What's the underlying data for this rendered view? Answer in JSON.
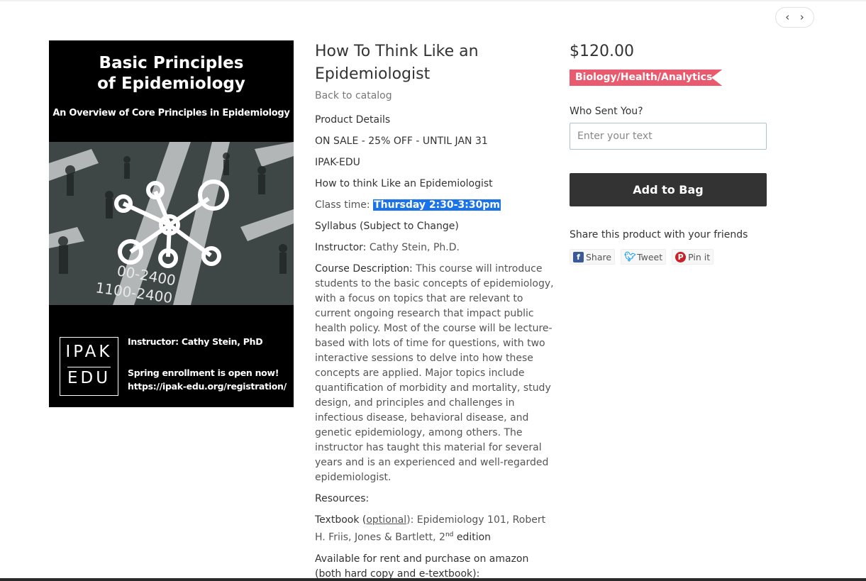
{
  "nav": {
    "prev": "‹",
    "next": "›"
  },
  "poster": {
    "title_line1": "Basic Principles",
    "title_line2": "of Epidemiology",
    "subtitle": "An Overview of Core Principles in Epidemiology",
    "logo_line1": "IPAK",
    "logo_line2": "EDU",
    "instructor": "Instructor: Cathy Stein, PhD",
    "enroll_line1": "Spring enrollment is open now!",
    "enroll_line2": "https://ipak-edu.org/registration/",
    "street_text_1": "00-2400",
    "street_text_2": "1100-2400"
  },
  "product": {
    "title": "How To Think Like an Epidemiologist",
    "back_link": "Back to catalog",
    "details_heading": "Product Details",
    "sale": "ON SALE - 25% OFF - UNTIL JAN 31",
    "org": "IPAK-EDU",
    "name_line": "How to think Like an Epidemiologist",
    "class_time_label": "Class time: ",
    "class_time_value": "Thursday 2:30-3:30pm",
    "syllabus": "Syllabus (Subject to Change)",
    "instructor_label": "Instructor: ",
    "instructor_value": "Cathy Stein, Ph.D.",
    "course_desc_label": "Course Description:",
    "course_desc_text": " This course will introduce students to the basic concepts of epidemiology, with a focus on topics that are relevant to current ongoing research that impact public health policy. Most of the course will be lecture-based with lots of time for questions, with two interactive sessions to delve into how these concepts are applied. Major topics include quantification of morbidity and mortality, study design, and principles and challenges in infectious disease, behavioral disease, and genetic epidemiology, among others. The instructor has taught this material for several years and is an experienced and well-regarded epidemiologist.",
    "resources": "Resources:",
    "textbook_label": "Textbook (",
    "textbook_optional": "optional",
    "textbook_close": "): ",
    "textbook_value": "Epidemiology 101, Robert H. Friis, Jones & Bartlett, 2",
    "textbook_sup": "nd",
    "textbook_edition": " edition",
    "available": "Available for rent and purchase on amazon (both hard copy and e-textbook):"
  },
  "purchase": {
    "price": "$120.00",
    "category": "Biology/Health/Analytics",
    "who_label": "Who Sent You?",
    "who_placeholder": "Enter your text",
    "add_button": "Add to Bag",
    "share_label": "Share this product with your friends",
    "share": "Share",
    "tweet": "Tweet",
    "pin": "Pin it"
  },
  "colors": {
    "tag": "#ea5a6f",
    "button": "#333333",
    "highlight": "#1a73e8"
  }
}
